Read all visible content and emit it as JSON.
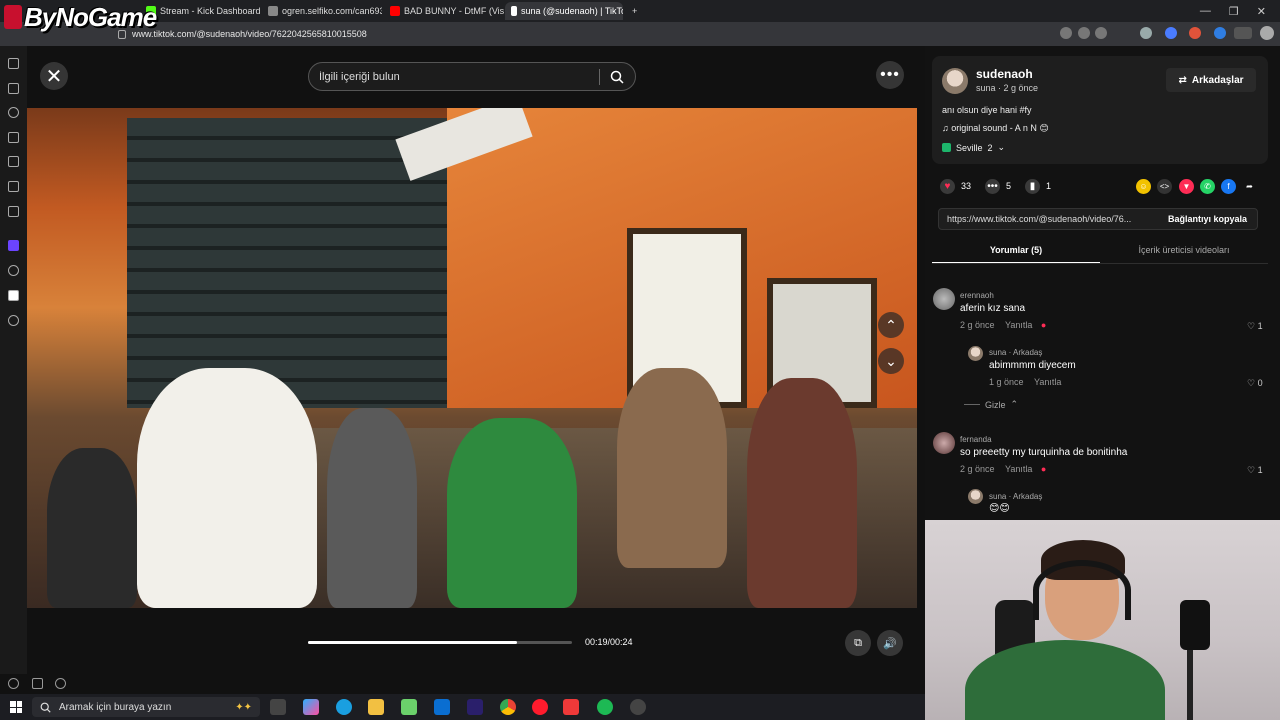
{
  "browser": {
    "tabs": [
      {
        "label": "ByNoGame",
        "color": "#c8102e"
      },
      {
        "label": "Stream - Kick Dashboard",
        "color": "#53fc18"
      },
      {
        "label": "ogren.selfiko.com/can693",
        "color": "#888888"
      },
      {
        "label": "BAD BUNNY - DtMF (Visua",
        "color": "#ff0000"
      },
      {
        "label": "suna (@sudenaoh) | TikTok",
        "color": "#ffffff"
      }
    ],
    "url": "www.tiktok.com/@sudenaoh/video/7622042565810015508",
    "window_controls": [
      "—",
      "❐",
      "✕"
    ]
  },
  "logo": {
    "text": "ByNoGame"
  },
  "video": {
    "search_placeholder": "İlgili içeriği bulun",
    "time": "00:19/00:24",
    "progress": 0.79
  },
  "post": {
    "username": "sudenaoh",
    "meta": "suna · 2 g önce",
    "friends_button": "Arkadaşlar",
    "description": "anı olsun diye hani #fy",
    "sound": "original sound - A n N 😊",
    "location": "Seville",
    "location_count": "2",
    "likes": "33",
    "comments": "5",
    "saves": "1",
    "link": "https://www.tiktok.com/@sudenaoh/video/76...",
    "copy_link": "Bağlantıyı kopyala",
    "tab_comments": "Yorumlar (5)",
    "tab_creator": "İçerik üreticisi videoları"
  },
  "comments": [
    {
      "name": "erennaoh",
      "text": "aferin kız sana",
      "time": "2 g önce",
      "reply": "Yanıtla",
      "likes": "1"
    },
    {
      "name": "suna · Arkadaş",
      "text": "abimmmm diyecem",
      "time": "1 g önce",
      "reply": "Yanıtla",
      "likes": "0"
    },
    {
      "name": "fernanda",
      "text": "so preeetty my turquinha de bonitinha",
      "time": "2 g önce",
      "reply": "Yanıtla",
      "likes": "1"
    },
    {
      "name": "suna · Arkadaş",
      "text": "😊😊"
    }
  ],
  "hide_label": "Gizle",
  "taskbar": {
    "search_placeholder": "Aramak için buraya yazın"
  },
  "colors": {
    "like": "#fe2c55",
    "accent_green": "#1db56b"
  }
}
